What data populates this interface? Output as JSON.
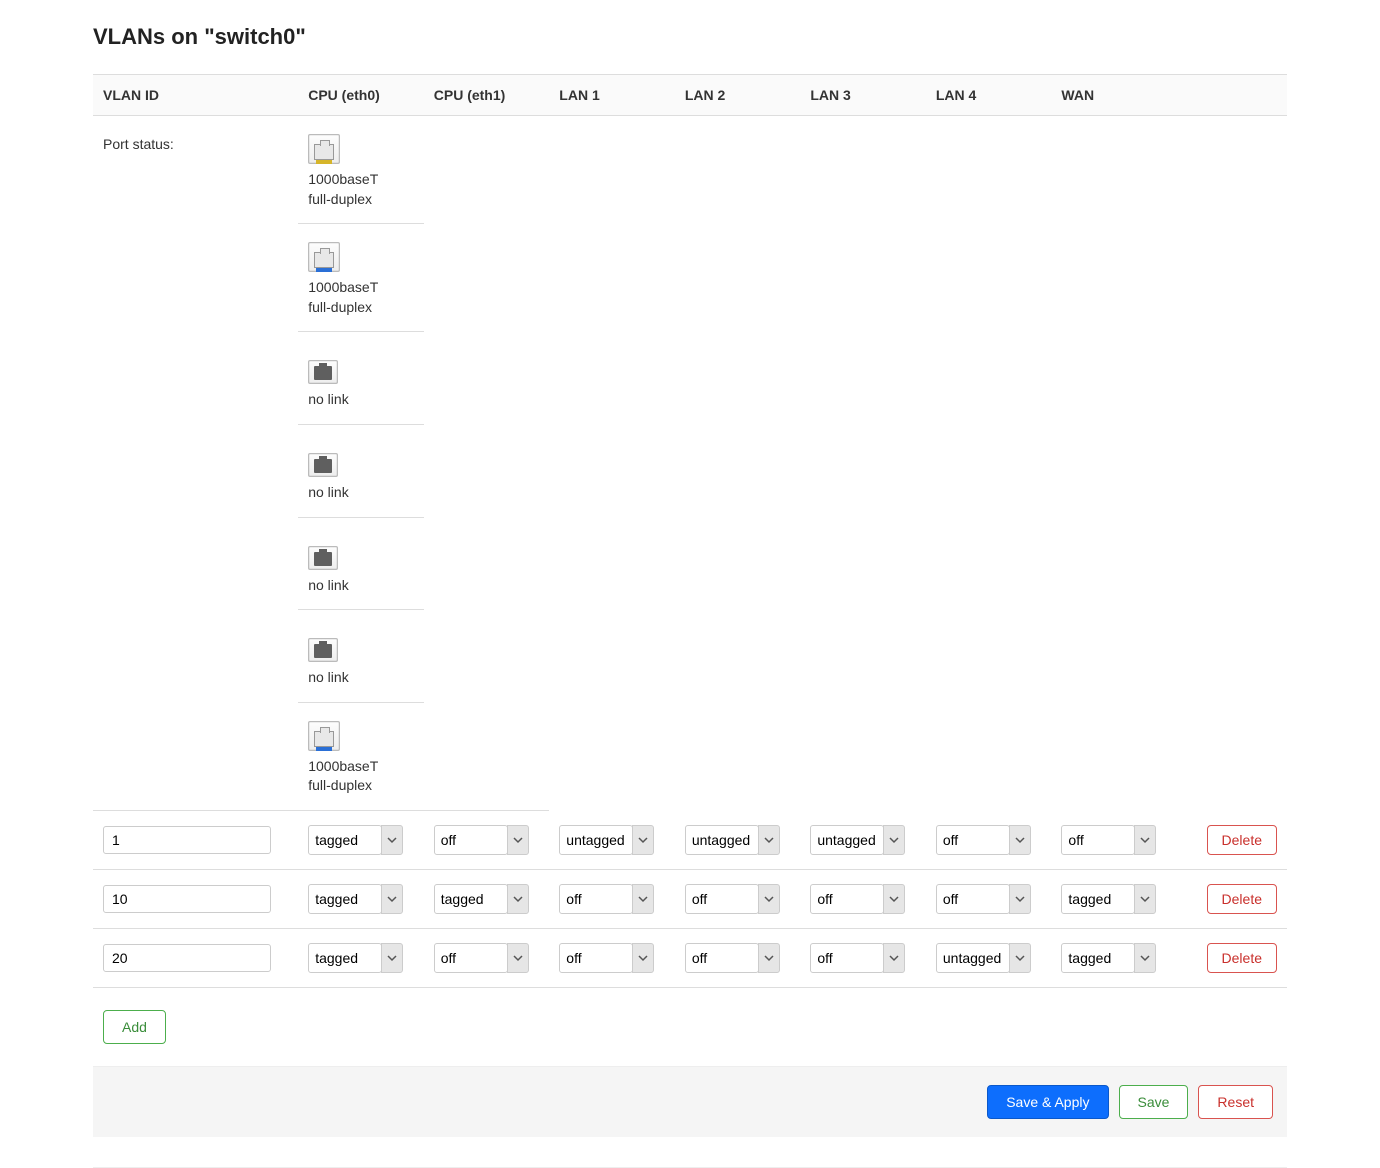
{
  "page_title": "VLANs on \"switch0\"",
  "columns": [
    "VLAN ID",
    "CPU (eth0)",
    "CPU (eth1)",
    "LAN 1",
    "LAN 2",
    "LAN 3",
    "LAN 4",
    "WAN"
  ],
  "port_status_label": "Port status:",
  "ports": [
    {
      "name": "CPU (eth0)",
      "link": true,
      "status": "1000baseT\nfull-duplex",
      "cable": "yellow"
    },
    {
      "name": "CPU (eth1)",
      "link": true,
      "status": "1000baseT\nfull-duplex",
      "cable": "blue"
    },
    {
      "name": "LAN 1",
      "link": false,
      "status": "no link",
      "cable": null
    },
    {
      "name": "LAN 2",
      "link": false,
      "status": "no link",
      "cable": null
    },
    {
      "name": "LAN 3",
      "link": false,
      "status": "no link",
      "cable": null
    },
    {
      "name": "LAN 4",
      "link": false,
      "status": "no link",
      "cable": null
    },
    {
      "name": "WAN",
      "link": true,
      "status": "1000baseT\nfull-duplex",
      "cable": "blue"
    }
  ],
  "select_options": [
    "off",
    "untagged",
    "tagged"
  ],
  "rows": [
    {
      "id": "1",
      "cells": [
        "tagged",
        "off",
        "untagged",
        "untagged",
        "untagged",
        "off",
        "off"
      ]
    },
    {
      "id": "10",
      "cells": [
        "tagged",
        "tagged",
        "off",
        "off",
        "off",
        "off",
        "tagged"
      ]
    },
    {
      "id": "20",
      "cells": [
        "tagged",
        "off",
        "off",
        "off",
        "off",
        "untagged",
        "tagged"
      ]
    }
  ],
  "buttons": {
    "delete": "Delete",
    "add": "Add",
    "save_apply": "Save & Apply",
    "save": "Save",
    "reset": "Reset"
  }
}
